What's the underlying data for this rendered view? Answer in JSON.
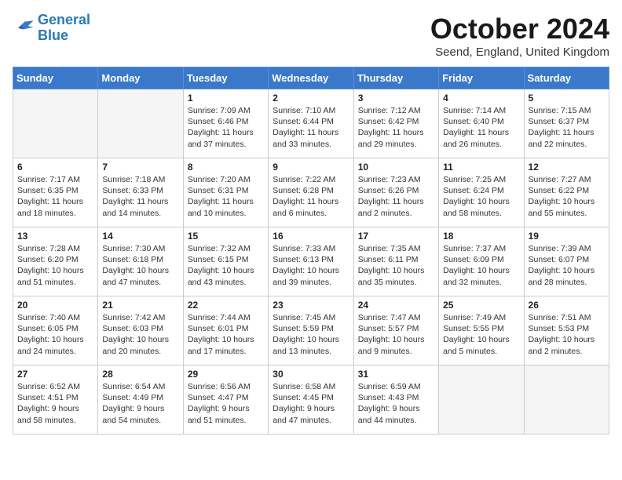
{
  "header": {
    "logo_line1": "General",
    "logo_line2": "Blue",
    "month": "October 2024",
    "location": "Seend, England, United Kingdom"
  },
  "days_of_week": [
    "Sunday",
    "Monday",
    "Tuesday",
    "Wednesday",
    "Thursday",
    "Friday",
    "Saturday"
  ],
  "weeks": [
    [
      {
        "day": "",
        "info": ""
      },
      {
        "day": "",
        "info": ""
      },
      {
        "day": "1",
        "info": "Sunrise: 7:09 AM\nSunset: 6:46 PM\nDaylight: 11 hours\nand 37 minutes."
      },
      {
        "day": "2",
        "info": "Sunrise: 7:10 AM\nSunset: 6:44 PM\nDaylight: 11 hours\nand 33 minutes."
      },
      {
        "day": "3",
        "info": "Sunrise: 7:12 AM\nSunset: 6:42 PM\nDaylight: 11 hours\nand 29 minutes."
      },
      {
        "day": "4",
        "info": "Sunrise: 7:14 AM\nSunset: 6:40 PM\nDaylight: 11 hours\nand 26 minutes."
      },
      {
        "day": "5",
        "info": "Sunrise: 7:15 AM\nSunset: 6:37 PM\nDaylight: 11 hours\nand 22 minutes."
      }
    ],
    [
      {
        "day": "6",
        "info": "Sunrise: 7:17 AM\nSunset: 6:35 PM\nDaylight: 11 hours\nand 18 minutes."
      },
      {
        "day": "7",
        "info": "Sunrise: 7:18 AM\nSunset: 6:33 PM\nDaylight: 11 hours\nand 14 minutes."
      },
      {
        "day": "8",
        "info": "Sunrise: 7:20 AM\nSunset: 6:31 PM\nDaylight: 11 hours\nand 10 minutes."
      },
      {
        "day": "9",
        "info": "Sunrise: 7:22 AM\nSunset: 6:28 PM\nDaylight: 11 hours\nand 6 minutes."
      },
      {
        "day": "10",
        "info": "Sunrise: 7:23 AM\nSunset: 6:26 PM\nDaylight: 11 hours\nand 2 minutes."
      },
      {
        "day": "11",
        "info": "Sunrise: 7:25 AM\nSunset: 6:24 PM\nDaylight: 10 hours\nand 58 minutes."
      },
      {
        "day": "12",
        "info": "Sunrise: 7:27 AM\nSunset: 6:22 PM\nDaylight: 10 hours\nand 55 minutes."
      }
    ],
    [
      {
        "day": "13",
        "info": "Sunrise: 7:28 AM\nSunset: 6:20 PM\nDaylight: 10 hours\nand 51 minutes."
      },
      {
        "day": "14",
        "info": "Sunrise: 7:30 AM\nSunset: 6:18 PM\nDaylight: 10 hours\nand 47 minutes."
      },
      {
        "day": "15",
        "info": "Sunrise: 7:32 AM\nSunset: 6:15 PM\nDaylight: 10 hours\nand 43 minutes."
      },
      {
        "day": "16",
        "info": "Sunrise: 7:33 AM\nSunset: 6:13 PM\nDaylight: 10 hours\nand 39 minutes."
      },
      {
        "day": "17",
        "info": "Sunrise: 7:35 AM\nSunset: 6:11 PM\nDaylight: 10 hours\nand 35 minutes."
      },
      {
        "day": "18",
        "info": "Sunrise: 7:37 AM\nSunset: 6:09 PM\nDaylight: 10 hours\nand 32 minutes."
      },
      {
        "day": "19",
        "info": "Sunrise: 7:39 AM\nSunset: 6:07 PM\nDaylight: 10 hours\nand 28 minutes."
      }
    ],
    [
      {
        "day": "20",
        "info": "Sunrise: 7:40 AM\nSunset: 6:05 PM\nDaylight: 10 hours\nand 24 minutes."
      },
      {
        "day": "21",
        "info": "Sunrise: 7:42 AM\nSunset: 6:03 PM\nDaylight: 10 hours\nand 20 minutes."
      },
      {
        "day": "22",
        "info": "Sunrise: 7:44 AM\nSunset: 6:01 PM\nDaylight: 10 hours\nand 17 minutes."
      },
      {
        "day": "23",
        "info": "Sunrise: 7:45 AM\nSunset: 5:59 PM\nDaylight: 10 hours\nand 13 minutes."
      },
      {
        "day": "24",
        "info": "Sunrise: 7:47 AM\nSunset: 5:57 PM\nDaylight: 10 hours\nand 9 minutes."
      },
      {
        "day": "25",
        "info": "Sunrise: 7:49 AM\nSunset: 5:55 PM\nDaylight: 10 hours\nand 5 minutes."
      },
      {
        "day": "26",
        "info": "Sunrise: 7:51 AM\nSunset: 5:53 PM\nDaylight: 10 hours\nand 2 minutes."
      }
    ],
    [
      {
        "day": "27",
        "info": "Sunrise: 6:52 AM\nSunset: 4:51 PM\nDaylight: 9 hours\nand 58 minutes."
      },
      {
        "day": "28",
        "info": "Sunrise: 6:54 AM\nSunset: 4:49 PM\nDaylight: 9 hours\nand 54 minutes."
      },
      {
        "day": "29",
        "info": "Sunrise: 6:56 AM\nSunset: 4:47 PM\nDaylight: 9 hours\nand 51 minutes."
      },
      {
        "day": "30",
        "info": "Sunrise: 6:58 AM\nSunset: 4:45 PM\nDaylight: 9 hours\nand 47 minutes."
      },
      {
        "day": "31",
        "info": "Sunrise: 6:59 AM\nSunset: 4:43 PM\nDaylight: 9 hours\nand 44 minutes."
      },
      {
        "day": "",
        "info": ""
      },
      {
        "day": "",
        "info": ""
      }
    ]
  ]
}
